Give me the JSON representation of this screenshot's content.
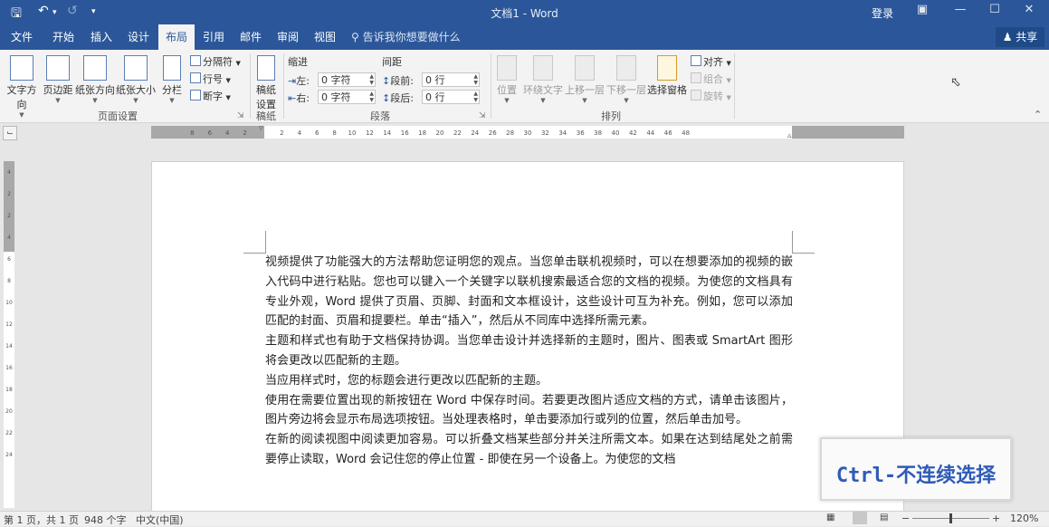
{
  "titlebar": {
    "title": "文档1 - Word",
    "login": "登录",
    "save_icon": "save-icon",
    "undo_icon": "undo-icon",
    "redo_icon": "redo-icon",
    "customize_icon": "customize-qat-icon"
  },
  "tabs": [
    {
      "label": "文件"
    },
    {
      "label": "开始"
    },
    {
      "label": "插入"
    },
    {
      "label": "设计"
    },
    {
      "label": "布局",
      "active": true
    },
    {
      "label": "引用"
    },
    {
      "label": "邮件"
    },
    {
      "label": "审阅"
    },
    {
      "label": "视图"
    }
  ],
  "tell_me": "告诉我你想要做什么",
  "share": "共享",
  "ribbon": {
    "page_setup": {
      "label": "页面设置",
      "text_direction": "文字方向",
      "margins": "页边距",
      "orientation": "纸张方向",
      "size": "纸张大小",
      "columns": "分栏",
      "breaks": "分隔符",
      "line_numbers": "行号",
      "hyphenation": "断字"
    },
    "draft": {
      "label": "稿纸",
      "button": "稿纸\n设置"
    },
    "paragraph": {
      "label": "段落",
      "indent_title": "缩进",
      "spacing_title": "间距",
      "left_label": "左:",
      "right_label": "右:",
      "left_value": "0 字符",
      "right_value": "0 字符",
      "before_label": "段前:",
      "after_label": "段后:",
      "before_value": "0 行",
      "after_value": "0 行"
    },
    "arrange": {
      "label": "排列",
      "position": "位置",
      "wrap_text": "环绕文字",
      "bring_forward": "上移一层",
      "send_backward": "下移一层",
      "selection_pane": "选择窗格",
      "align": "对齐",
      "group": "组合",
      "rotate": "旋转"
    }
  },
  "ruler": {
    "labels": [
      "8",
      "6",
      "4",
      "2",
      "2",
      "4",
      "6",
      "8",
      "10",
      "12",
      "14",
      "16",
      "18",
      "20",
      "22",
      "24",
      "26",
      "28",
      "30",
      "32",
      "34",
      "36",
      "38",
      "40",
      "42",
      "44",
      "46",
      "48"
    ],
    "left_labels_count": 4
  },
  "vruler": {
    "labels": [
      "4",
      "2",
      "2",
      "4",
      "6",
      "8",
      "10",
      "12",
      "14",
      "16",
      "18",
      "20",
      "22",
      "24"
    ]
  },
  "document": {
    "paragraphs": [
      "视频提供了功能强大的方法帮助您证明您的观点。当您单击联机视频时，可以在想要添加的视频的嵌入代码中进行粘贴。您也可以键入一个关键字以联机搜索最适合您的文档的视频。为使您的文档具有专业外观，Word 提供了页眉、页脚、封面和文本框设计，这些设计可互为补充。例如，您可以添加匹配的封面、页眉和提要栏。单击“插入”，然后从不同库中选择所需元素。",
      "主题和样式也有助于文档保持协调。当您单击设计并选择新的主题时，图片、图表或 SmartArt 图形将会更改以匹配新的主题。",
      "当应用样式时，您的标题会进行更改以匹配新的主题。",
      "使用在需要位置出现的新按钮在 Word 中保存时间。若要更改图片适应文档的方式，请单击该图片，图片旁边将会显示布局选项按钮。当处理表格时，单击要添加行或列的位置，然后单击加号。",
      "在新的阅读视图中阅读更加容易。可以折叠文档某些部分并关注所需文本。如果在达到结尾处之前需要停止读取，Word 会记住您的停止位置 - 即使在另一个设备上。为使您的文档"
    ]
  },
  "statusbar": {
    "page": "第 1 页，共 1 页",
    "words": "948 个字",
    "language": "中文(中国)",
    "zoom": "120%",
    "zoom_minus": "−",
    "zoom_plus": "+"
  },
  "overlay": {
    "text": "Ctrl-不连续选择"
  },
  "colors": {
    "accent": "#2b579a",
    "overlay_text": "#2f5bb7"
  }
}
